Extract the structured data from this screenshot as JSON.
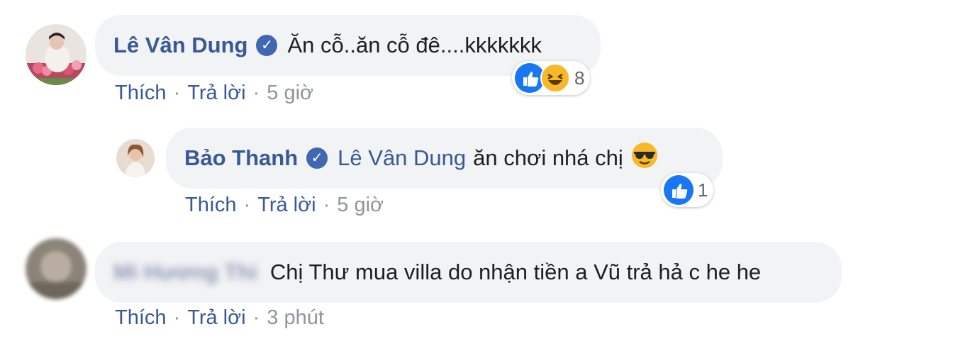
{
  "comments": [
    {
      "author": "Lê Vân Dung",
      "verified": true,
      "text": "Ăn cỗ..ăn cỗ đê....kkkkkkk",
      "reaction_count": "8",
      "reaction_types": [
        "like-icon",
        "haha-icon"
      ],
      "actions": {
        "like": "Thích",
        "reply": "Trả lời",
        "time": "5 giờ"
      }
    },
    {
      "author": "Bảo Thanh",
      "verified": true,
      "mention": "Lê Vân Dung",
      "text": "ăn chơi nhá chị",
      "emoji": "sunglasses-emoji-icon",
      "reaction_count": "1",
      "reaction_types": [
        "like-icon"
      ],
      "actions": {
        "like": "Thích",
        "reply": "Trả lời",
        "time": "5 giờ"
      }
    },
    {
      "author": "Mi Hương Thi",
      "verified": false,
      "author_blurred": true,
      "text": "Chị Thư mua villa do nhận tiền a Vũ trả hả c he he",
      "actions": {
        "like": "Thích",
        "reply": "Trả lời",
        "time": "3 phút"
      }
    }
  ],
  "colors": {
    "author": "#385898",
    "bubble": "#f2f3f5",
    "meta": "#90949c",
    "like_blue": "#1877f2",
    "haha_yellow": "#f7b928"
  }
}
